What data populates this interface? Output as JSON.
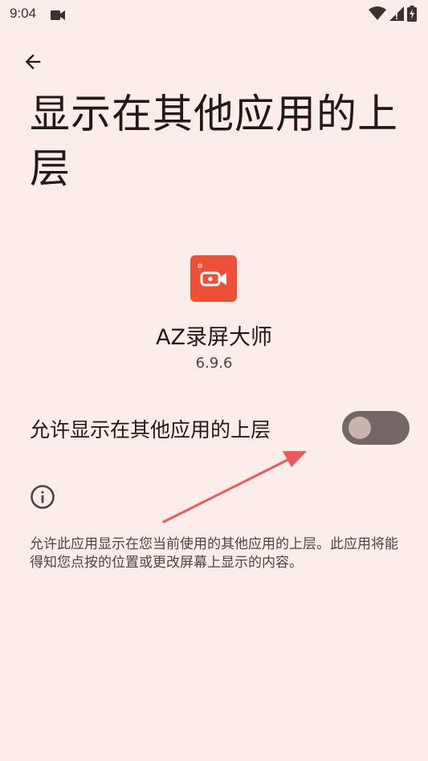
{
  "status_bar": {
    "time": "9:04",
    "icons": [
      "video-camera-icon",
      "wifi-icon",
      "signal-icon",
      "battery-charging-icon"
    ]
  },
  "header": {
    "back_icon": "arrow-left-icon",
    "title": "显示在其他应用的上层"
  },
  "app": {
    "icon": "screen-recorder-app-icon",
    "icon_color": "#ee4f37",
    "name": "AZ录屏大师",
    "version": "6.9.6"
  },
  "permission": {
    "label": "允许显示在其他应用的上层",
    "enabled": false
  },
  "info": {
    "icon": "info-icon",
    "description": "允许此应用显示在您当前使用的其他应用的上层。此应用将能得知您点按的位置或更改屏幕上显示的内容。"
  },
  "colors": {
    "background": "#fcecea",
    "switch_track": "#746664",
    "switch_thumb": "#c9b4b0",
    "annotation_arrow": "#ee5a5a"
  }
}
